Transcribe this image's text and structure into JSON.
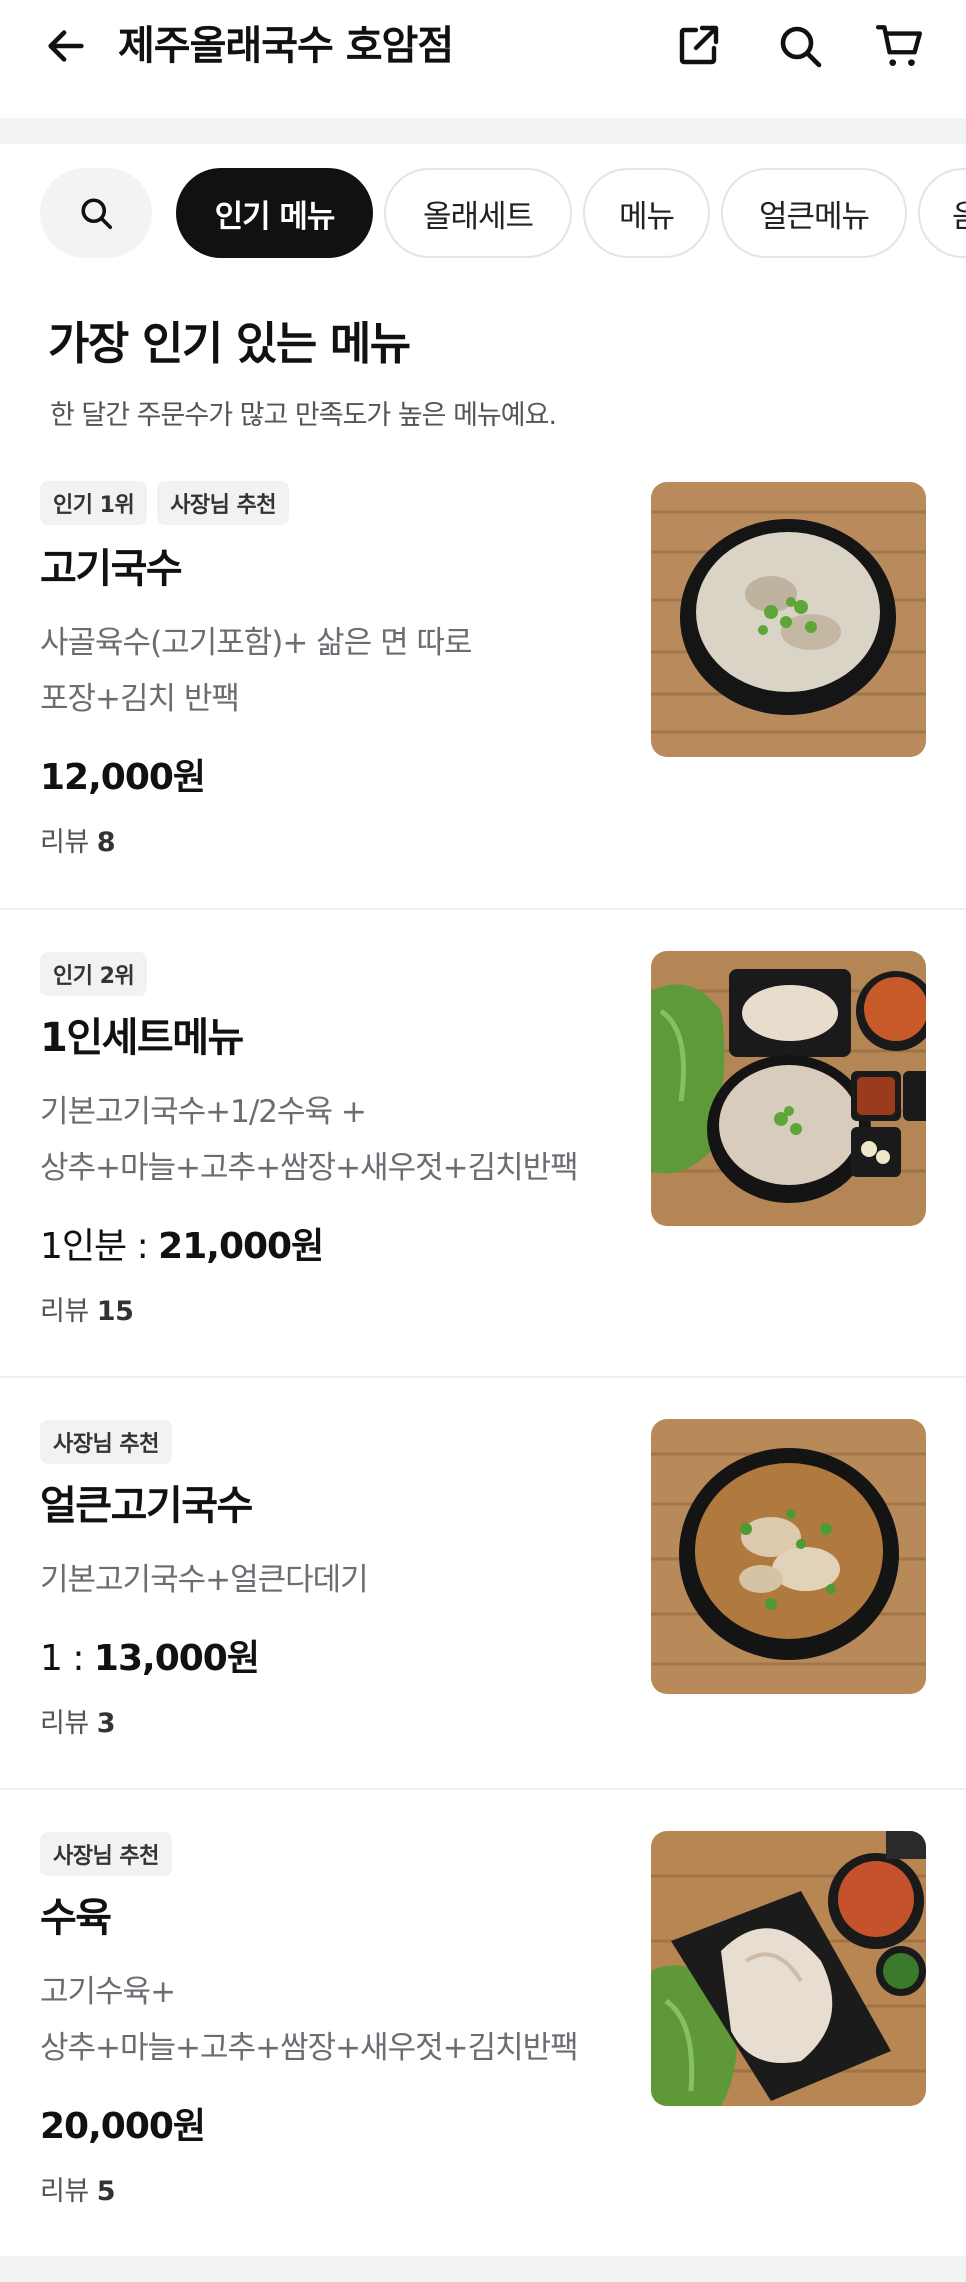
{
  "header": {
    "title": "제주올래국수 호암점",
    "back_icon": "arrow-left-icon",
    "share_icon": "share-icon",
    "search_icon": "search-icon",
    "cart_icon": "cart-icon"
  },
  "chips": {
    "search_icon": "search-icon",
    "items": [
      {
        "label": "인기 메뉴",
        "active": true
      },
      {
        "label": "올래세트",
        "active": false
      },
      {
        "label": "메뉴",
        "active": false
      },
      {
        "label": "얼큰메뉴",
        "active": false
      },
      {
        "label": "음",
        "active": false
      }
    ]
  },
  "section": {
    "title": "가장 인기 있는 메뉴",
    "subtitle": "한 달간 주문수가 많고 만족도가 높은 메뉴예요."
  },
  "menu": [
    {
      "badges": [
        "인기 1위",
        "사장님 추천"
      ],
      "name": "고기국수",
      "desc_lines": [
        "사골육수(고기포함)+ 삶은 면 따로",
        "포장+김치 반팩"
      ],
      "price_prefix": "",
      "price": "12,000원",
      "review_label": "리뷰",
      "review_count": "8"
    },
    {
      "badges": [
        "인기 2위"
      ],
      "name": "1인세트메뉴",
      "desc_lines": [
        "기본고기국수+1/2수육 +",
        "상추+마늘+고추+쌈장+새우젓+김치반팩"
      ],
      "price_prefix": "1인분 : ",
      "price": "21,000원",
      "review_label": "리뷰",
      "review_count": "15"
    },
    {
      "badges": [
        "사장님 추천"
      ],
      "name": "얼큰고기국수",
      "desc_lines": [
        "기본고기국수+얼큰다데기"
      ],
      "price_prefix": "1 : ",
      "price": "13,000원",
      "review_label": "리뷰",
      "review_count": "3"
    },
    {
      "badges": [
        "사장님 추천"
      ],
      "name": "수육",
      "desc_lines": [
        "고기수육+",
        "상추+마늘+고추+쌈장+새우젓+김치반팩"
      ],
      "price_prefix": "",
      "price": "20,000원",
      "review_label": "리뷰",
      "review_count": "5"
    }
  ],
  "colors": {
    "accent": "#111111",
    "muted_text": "#6b6d72",
    "divider": "#eeeff1",
    "band": "#f2f3f5"
  }
}
